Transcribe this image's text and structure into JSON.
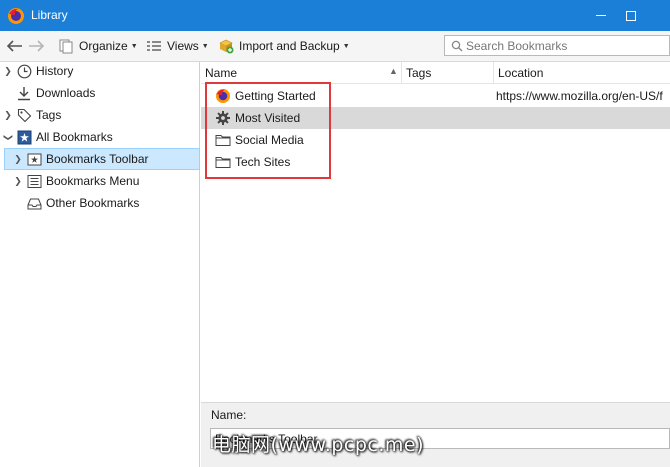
{
  "window": {
    "title": "Library",
    "icon": "firefox-icon"
  },
  "toolbar": {
    "organize_label": "Organize",
    "views_label": "Views",
    "import_backup_label": "Import and Backup",
    "search_placeholder": "Search Bookmarks"
  },
  "sidebar": {
    "items": [
      {
        "label": "History",
        "icon": "clock-icon"
      },
      {
        "label": "Downloads",
        "icon": "download-icon"
      },
      {
        "label": "Tags",
        "icon": "tag-icon"
      },
      {
        "label": "All Bookmarks",
        "icon": "bookmarks-icon"
      },
      {
        "label": "Bookmarks Toolbar",
        "icon": "bookmarks-toolbar-icon"
      },
      {
        "label": "Bookmarks Menu",
        "icon": "bookmarks-menu-icon"
      },
      {
        "label": "Other Bookmarks",
        "icon": "tray-icon"
      }
    ],
    "selected": "Bookmarks Toolbar"
  },
  "columns": {
    "name": "Name",
    "tags": "Tags",
    "location": "Location"
  },
  "rows": [
    {
      "name": "Getting Started",
      "icon": "firefox-icon",
      "location": "https://www.mozilla.org/en-US/f"
    },
    {
      "name": "Most Visited",
      "icon": "gear-icon",
      "location": ""
    },
    {
      "name": "Social Media",
      "icon": "folder-icon",
      "location": ""
    },
    {
      "name": "Tech Sites",
      "icon": "folder-icon",
      "location": ""
    }
  ],
  "details": {
    "name_label": "Name:",
    "name_value": "Bookmarks Toolbar"
  },
  "watermark": "电脑网(www.pcpc.me)",
  "colors": {
    "titlebar": "#1b7fd8",
    "selection": "#cce8ff",
    "row_highlight": "#d9d9d9",
    "annotation_box": "#e0393c"
  }
}
